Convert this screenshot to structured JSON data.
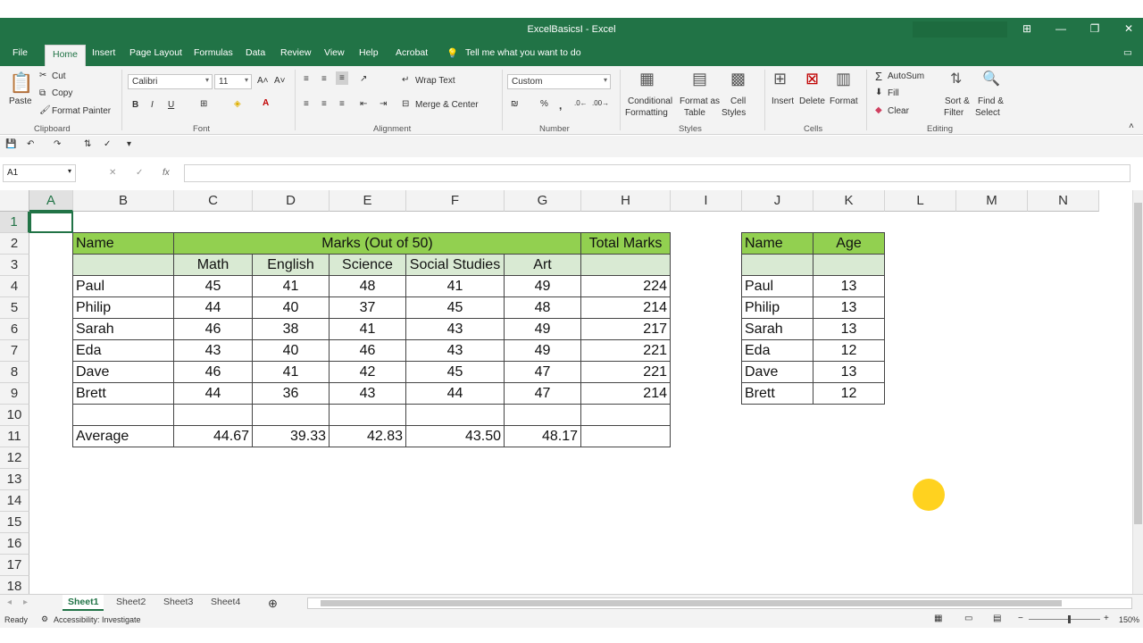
{
  "window": {
    "title": "ExcelBasicsI  -  Excel"
  },
  "tabs": [
    "File",
    "Home",
    "Insert",
    "Page Layout",
    "Formulas",
    "Data",
    "Review",
    "View",
    "Help",
    "Acrobat"
  ],
  "tell_me": "Tell me what you want to do",
  "ribbon": {
    "clipboard": {
      "paste": "Paste",
      "cut": "Cut",
      "copy": "Copy",
      "format_painter": "Format Painter",
      "label": "Clipboard"
    },
    "font": {
      "name": "Calibri",
      "size": "11",
      "label": "Font"
    },
    "alignment": {
      "wrap": "Wrap Text",
      "merge": "Merge & Center",
      "label": "Alignment"
    },
    "number": {
      "format": "Custom",
      "label": "Number"
    },
    "styles": {
      "cond1": "Conditional",
      "cond2": "Formatting",
      "fmt1": "Format as",
      "fmt2": "Table",
      "cell1": "Cell",
      "cell2": "Styles",
      "label": "Styles"
    },
    "cells": {
      "insert": "Insert",
      "delete": "Delete",
      "format": "Format",
      "label": "Cells"
    },
    "editing": {
      "autosum": "AutoSum",
      "fill": "Fill",
      "clear": "Clear",
      "sort1": "Sort &",
      "sort2": "Filter",
      "find1": "Find &",
      "find2": "Select",
      "label": "Editing"
    }
  },
  "formula_bar": {
    "name_box": "A1",
    "fx": "fx"
  },
  "columns": [
    "A",
    "B",
    "C",
    "D",
    "E",
    "F",
    "G",
    "H",
    "I",
    "J",
    "K",
    "L",
    "M",
    "N"
  ],
  "rows": [
    "1",
    "2",
    "3",
    "4",
    "5",
    "6",
    "7",
    "8",
    "9",
    "10",
    "11",
    "12",
    "13",
    "14",
    "15",
    "16",
    "17",
    "18"
  ],
  "table1": {
    "name_header": "Name",
    "marks_header": "Marks (Out of 50)",
    "total_header": "Total Marks",
    "subjects": [
      "Math",
      "English",
      "Science",
      "Social Studies",
      "Art"
    ],
    "rows": [
      {
        "name": "Paul",
        "marks": [
          "45",
          "41",
          "48",
          "41",
          "49"
        ],
        "total": "224"
      },
      {
        "name": "Philip",
        "marks": [
          "44",
          "40",
          "37",
          "45",
          "48"
        ],
        "total": "214"
      },
      {
        "name": "Sarah",
        "marks": [
          "46",
          "38",
          "41",
          "43",
          "49"
        ],
        "total": "217"
      },
      {
        "name": "Eda",
        "marks": [
          "43",
          "40",
          "46",
          "43",
          "49"
        ],
        "total": "221"
      },
      {
        "name": "Dave",
        "marks": [
          "46",
          "41",
          "42",
          "45",
          "47"
        ],
        "total": "221"
      },
      {
        "name": "Brett",
        "marks": [
          "44",
          "36",
          "43",
          "44",
          "47"
        ],
        "total": "214"
      }
    ],
    "average_label": "Average",
    "averages": [
      "44.67",
      "39.33",
      "42.83",
      "43.50",
      "48.17"
    ]
  },
  "table2": {
    "name_header": "Name",
    "age_header": "Age",
    "rows": [
      {
        "name": "Paul",
        "age": "13"
      },
      {
        "name": "Philip",
        "age": "13"
      },
      {
        "name": "Sarah",
        "age": "13"
      },
      {
        "name": "Eda",
        "age": "12"
      },
      {
        "name": "Dave",
        "age": "13"
      },
      {
        "name": "Brett",
        "age": "12"
      }
    ]
  },
  "sheets": [
    "Sheet1",
    "Sheet2",
    "Sheet3",
    "Sheet4"
  ],
  "status": {
    "ready": "Ready",
    "accessibility": "Accessibility: Investigate",
    "zoom": "150%"
  },
  "colors": {
    "brand": "#217346",
    "header_green": "#92d050",
    "light_green": "#d9ead3"
  }
}
